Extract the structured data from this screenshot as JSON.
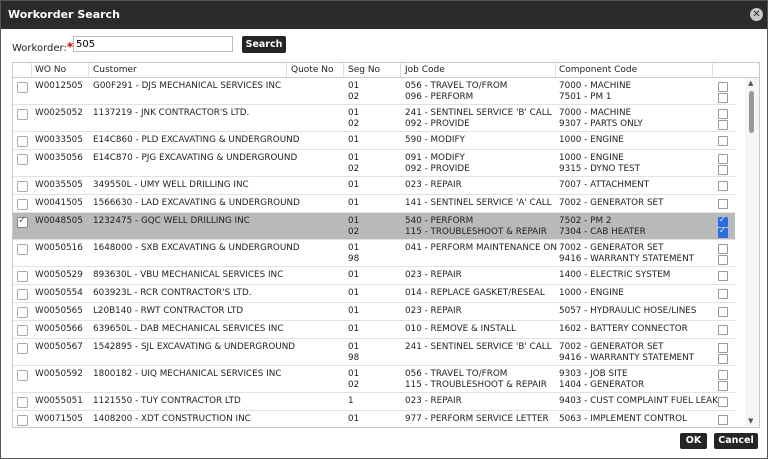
{
  "dialog": {
    "title": "Workorder Search"
  },
  "search": {
    "label": "Workorder:",
    "required_mark": "*",
    "value": "505",
    "button": "Search"
  },
  "columns": [
    "WO No",
    "Customer",
    "Quote No",
    "Seg No",
    "Job Code",
    "Component Code"
  ],
  "rows": [
    {
      "wo": "W0012505",
      "customer": "G00F291 - DJS MECHANICAL SERVICES INC",
      "quote": "",
      "segs": [
        {
          "seg": "01",
          "job": "056 - TRAVEL TO/FROM",
          "comp": "7000 - MACHINE",
          "checked": false
        },
        {
          "seg": "02",
          "job": "096 - PERFORM",
          "comp": "7501 - PM 1",
          "checked": false
        }
      ],
      "selected": false
    },
    {
      "wo": "W0025052",
      "customer": "1137219 - JNK CONTRACTOR'S LTD.",
      "quote": "",
      "segs": [
        {
          "seg": "01",
          "job": "241 - SENTINEL SERVICE 'B' CALL",
          "comp": "7000 - MACHINE",
          "checked": false
        },
        {
          "seg": "02",
          "job": "092 - PROVIDE",
          "comp": "9307 - PARTS ONLY",
          "checked": false
        }
      ],
      "selected": false
    },
    {
      "wo": "W0033505",
      "customer": "E14C860 - PLD EXCAVATING & UNDERGROUND",
      "quote": "",
      "segs": [
        {
          "seg": "01",
          "job": "590 - MODIFY",
          "comp": "1000 - ENGINE",
          "checked": false
        }
      ],
      "selected": false
    },
    {
      "wo": "W0035056",
      "customer": "E14C870 - PJG EXCAVATING & UNDERGROUND",
      "quote": "",
      "segs": [
        {
          "seg": "01",
          "job": "091 - MODIFY",
          "comp": "1000 - ENGINE",
          "checked": false
        },
        {
          "seg": "02",
          "job": "092 - PROVIDE",
          "comp": "9315 - DYNO TEST",
          "checked": false
        }
      ],
      "selected": false
    },
    {
      "wo": "W0035505",
      "customer": "349550L - UMY WELL DRILLING INC",
      "quote": "",
      "segs": [
        {
          "seg": "01",
          "job": "023 - REPAIR",
          "comp": "7007 - ATTACHMENT",
          "checked": false
        }
      ],
      "selected": false
    },
    {
      "wo": "W0041505",
      "customer": "1566630 - LAD EXCAVATING & UNDERGROUND",
      "quote": "",
      "segs": [
        {
          "seg": "01",
          "job": "141 - SENTINEL SERVICE 'A' CALL",
          "comp": "7002 - GENERATOR SET",
          "checked": false
        }
      ],
      "selected": false
    },
    {
      "wo": "W0048505",
      "customer": "1232475 - GQC WELL DRILLING INC",
      "quote": "",
      "segs": [
        {
          "seg": "01",
          "job": "540 - PERFORM",
          "comp": "7502 - PM 2",
          "checked": true
        },
        {
          "seg": "02",
          "job": "115 - TROUBLESHOOT & REPAIR",
          "comp": "7304 - CAB HEATER",
          "checked": true
        }
      ],
      "selected": true
    },
    {
      "wo": "W0050516",
      "customer": "1648000 - SXB EXCAVATING & UNDERGROUND",
      "quote": "",
      "segs": [
        {
          "seg": "01",
          "job": "041 - PERFORM MAINTENANCE ON",
          "comp": "7002 - GENERATOR SET",
          "checked": false
        },
        {
          "seg": "98",
          "job": "",
          "comp": "9416 - WARRANTY STATEMENT",
          "checked": false
        }
      ],
      "selected": false
    },
    {
      "wo": "W0050529",
      "customer": "893630L - VBU MECHANICAL SERVICES INC",
      "quote": "",
      "segs": [
        {
          "seg": "01",
          "job": "023 - REPAIR",
          "comp": "1400 - ELECTRIC SYSTEM",
          "checked": false
        }
      ],
      "selected": false
    },
    {
      "wo": "W0050554",
      "customer": "603923L - RCR CONTRACTOR'S LTD.",
      "quote": "",
      "segs": [
        {
          "seg": "01",
          "job": "014 - REPLACE GASKET/RESEAL",
          "comp": "1000 - ENGINE",
          "checked": false
        }
      ],
      "selected": false
    },
    {
      "wo": "W0050565",
      "customer": "L20B140 - RWT CONTRACTOR LTD",
      "quote": "",
      "segs": [
        {
          "seg": "01",
          "job": "023 - REPAIR",
          "comp": "5057 - HYDRAULIC HOSE/LINES",
          "checked": false
        }
      ],
      "selected": false
    },
    {
      "wo": "W0050566",
      "customer": "639650L - DAB MECHANICAL SERVICES INC",
      "quote": "",
      "segs": [
        {
          "seg": "01",
          "job": "010 - REMOVE & INSTALL",
          "comp": "1602 - BATTERY CONNECTOR",
          "checked": false
        }
      ],
      "selected": false
    },
    {
      "wo": "W0050567",
      "customer": "1542895 - SJL EXCAVATING & UNDERGROUND",
      "quote": "",
      "segs": [
        {
          "seg": "01",
          "job": "241 - SENTINEL SERVICE 'B' CALL",
          "comp": "7002 - GENERATOR SET",
          "checked": false
        },
        {
          "seg": "98",
          "job": "",
          "comp": "9416 - WARRANTY STATEMENT",
          "checked": false
        }
      ],
      "selected": false
    },
    {
      "wo": "W0050592",
      "customer": "1800182 - UIQ MECHANICAL SERVICES INC",
      "quote": "",
      "segs": [
        {
          "seg": "01",
          "job": "056 - TRAVEL TO/FROM",
          "comp": "9303 - JOB SITE",
          "checked": false
        },
        {
          "seg": "02",
          "job": "115 - TROUBLESHOOT & REPAIR",
          "comp": "1404 - GENERATOR",
          "checked": false
        }
      ],
      "selected": false
    },
    {
      "wo": "W0055051",
      "customer": "1121550 - TUY CONTRACTOR LTD",
      "quote": "",
      "segs": [
        {
          "seg": "1",
          "job": "023 - REPAIR",
          "comp": "9403 - CUST COMPLAINT FUEL LEAK",
          "checked": false
        }
      ],
      "selected": false
    },
    {
      "wo": "W0071505",
      "customer": "1408200 - XDT CONSTRUCTION INC",
      "quote": "",
      "segs": [
        {
          "seg": "01",
          "job": "977 - PERFORM SERVICE LETTER",
          "comp": "5063 - IMPLEMENT CONTROL",
          "checked": false
        }
      ],
      "selected": false
    }
  ],
  "footer": {
    "ok": "OK",
    "cancel": "Cancel"
  },
  "colors": {
    "titlebar": "#2b2b2b",
    "selected_row": "#b9b9b9",
    "required": "#d40000",
    "checkbox_checked": "#2a6de0"
  },
  "icons": {
    "close": "close-icon",
    "scroll_up": "chevron-up-icon",
    "scroll_down": "chevron-down-icon"
  }
}
